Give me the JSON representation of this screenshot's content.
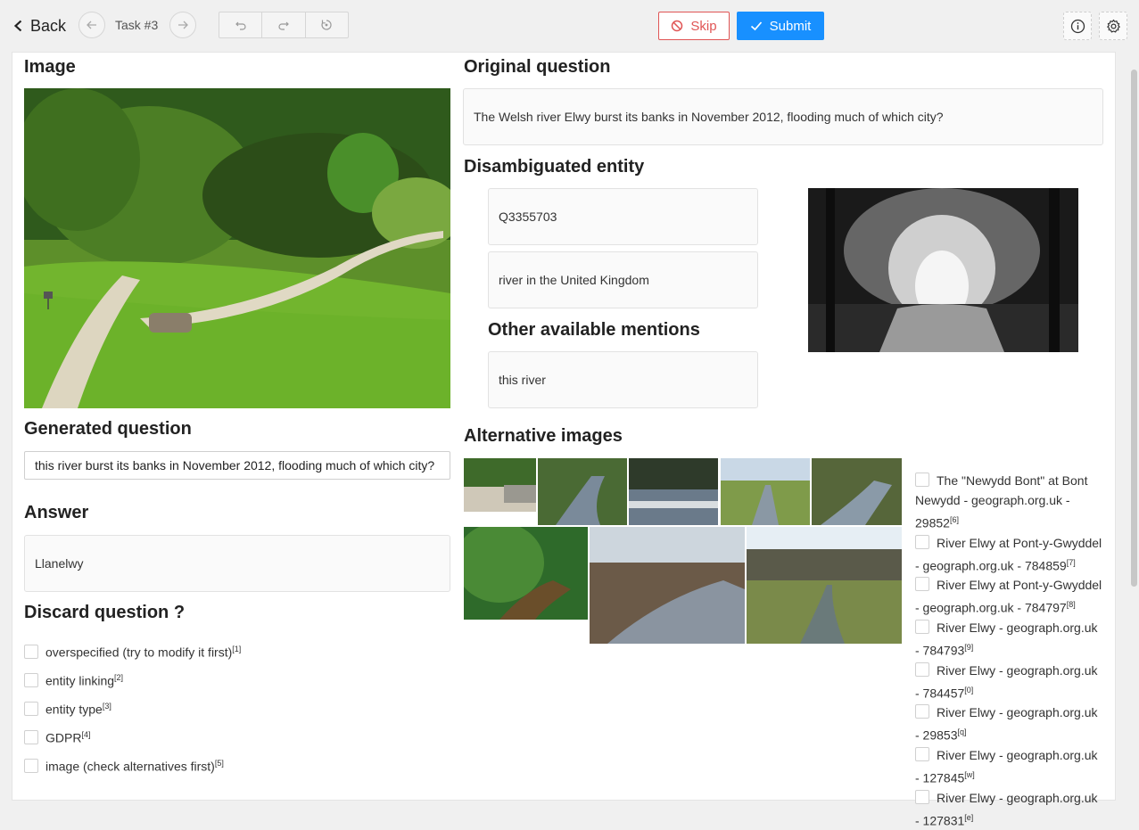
{
  "topbar": {
    "back_label": "Back",
    "task_label": "Task #3",
    "skip_label": "Skip",
    "submit_label": "Submit"
  },
  "colors": {
    "accent": "#1890ff",
    "danger": "#e05555"
  },
  "image_section": {
    "heading": "Image"
  },
  "original_question": {
    "heading": "Original question",
    "text": "The Welsh river Elwy burst its banks in November 2012, flooding much of which city?"
  },
  "disambiguated_entity": {
    "heading": "Disambiguated entity",
    "id": "Q3355703",
    "description": "river in the United Kingdom"
  },
  "other_mentions": {
    "heading": "Other available mentions",
    "value": "this river"
  },
  "generated_question": {
    "heading": "Generated question",
    "value": "this river burst its banks in November 2012, flooding much of which city?"
  },
  "answer": {
    "heading": "Answer",
    "value": "Llanelwy"
  },
  "discard": {
    "heading": "Discard question ?",
    "options": [
      {
        "label": "overspecified (try to modify it first)",
        "key": "[1]"
      },
      {
        "label": "entity linking",
        "key": "[2]"
      },
      {
        "label": "entity type",
        "key": "[3]"
      },
      {
        "label": "GDPR",
        "key": "[4]"
      },
      {
        "label": "image (check alternatives first)",
        "key": "[5]"
      }
    ]
  },
  "alternative_images": {
    "heading": "Alternative images",
    "items": [
      {
        "label": "The \"Newydd Bont\" at Bont Newydd - geograph.org.uk - 29852",
        "key": "[6]"
      },
      {
        "label": "River Elwy at Pont-y-Gwyddel - geograph.org.uk - 784859",
        "key": "[7]"
      },
      {
        "label": "River Elwy at Pont-y-Gwyddel - geograph.org.uk - 784797",
        "key": "[8]"
      },
      {
        "label": "River Elwy - geograph.org.uk - 784793",
        "key": "[9]"
      },
      {
        "label": "River Elwy - geograph.org.uk - 784457",
        "key": "[0]"
      },
      {
        "label": "River Elwy - geograph.org.uk - 29853",
        "key": "[q]"
      },
      {
        "label": "River Elwy - geograph.org.uk - 127845",
        "key": "[w]"
      },
      {
        "label": "River Elwy - geograph.org.uk - 127831",
        "key": "[e]"
      }
    ]
  }
}
